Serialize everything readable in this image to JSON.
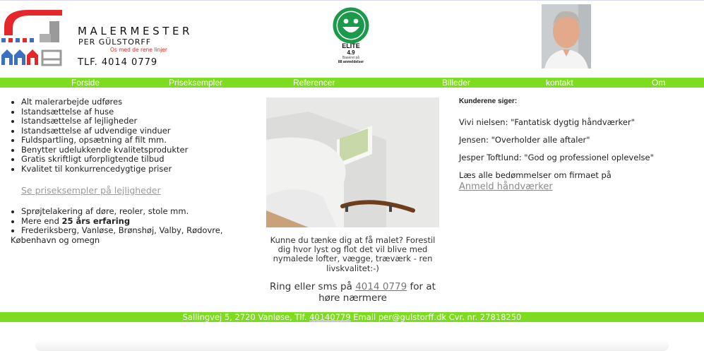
{
  "header": {
    "brand_title": "MALERMESTER",
    "brand_name": "PER GÜLSTORFF",
    "brand_tagline": "Os med de rene linjer",
    "brand_phone": "TLF. 4014 0779"
  },
  "rating_badge": {
    "label": "ELITE",
    "score": "4.9",
    "based_on": "Baseret på",
    "count": "88 anmeldelser",
    "color": "#1a9a4a"
  },
  "nav": {
    "items": [
      "Forside",
      "Priseksempler",
      "Referencer",
      "Billeder",
      "kontakt",
      "Om"
    ]
  },
  "services": {
    "items": [
      "Alt malerarbejde udføres",
      "Istandsættelse af huse",
      "Istandsættelse af lejligheder",
      "Istandsættelse af udvendige vinduer",
      "Fuldspartling, opsætning af filt mm.",
      "Benytter udelukkende kvalitetsprodukter",
      "Gratis skriftligt uforpligtende tilbud",
      "Kvalitet til konkurrencedygtige priser"
    ],
    "price_link": "Se priseksempler på lejligheder",
    "extra_item_1": "Sprøjtelakering af døre, reoler, stole mm.",
    "extra_item_2_prefix": "Mere end ",
    "extra_item_2_bold": "25 års erfaring",
    "extra_item_3_line1": "Frederiksberg, Vanløse, Brønshøj, Valby, Rødovre,",
    "extra_item_3_line2": "København og omegn"
  },
  "center": {
    "caption": "Kunne du tænke dig at få malet? Forestil dig hvor lyst og flot det vil blive med nymalede lofter, vægge, træværk - ren livskvalitet:-)",
    "ring_prefix": "Ring eller sms på ",
    "ring_phone": "4014 0779",
    "ring_suffix": " for at høre nærmere"
  },
  "testimonials": {
    "heading": "Kunderene siger:",
    "reviews": [
      "Vivi nielsen: \"Fantatisk dygtig håndværker\"",
      "Jensen: \"Overholder alle aftaler\"",
      "Jesper Toftlund: \"God og professionel oplevelse\""
    ],
    "all_text": "Læs alle bedømmelser om firmaet på",
    "link": "Anmeld håndværker"
  },
  "footer": {
    "prefix": "Sallingvej 5, 2720 Vanløse, Tlf. ",
    "phone": "40140779",
    "suffix": " Email per@gulstorff.dk Cvr. nr. 27818250"
  },
  "colors": {
    "nav_green": "#7ddc1f",
    "accent_red": "#d62828",
    "link_gray": "#9a9a9a"
  }
}
